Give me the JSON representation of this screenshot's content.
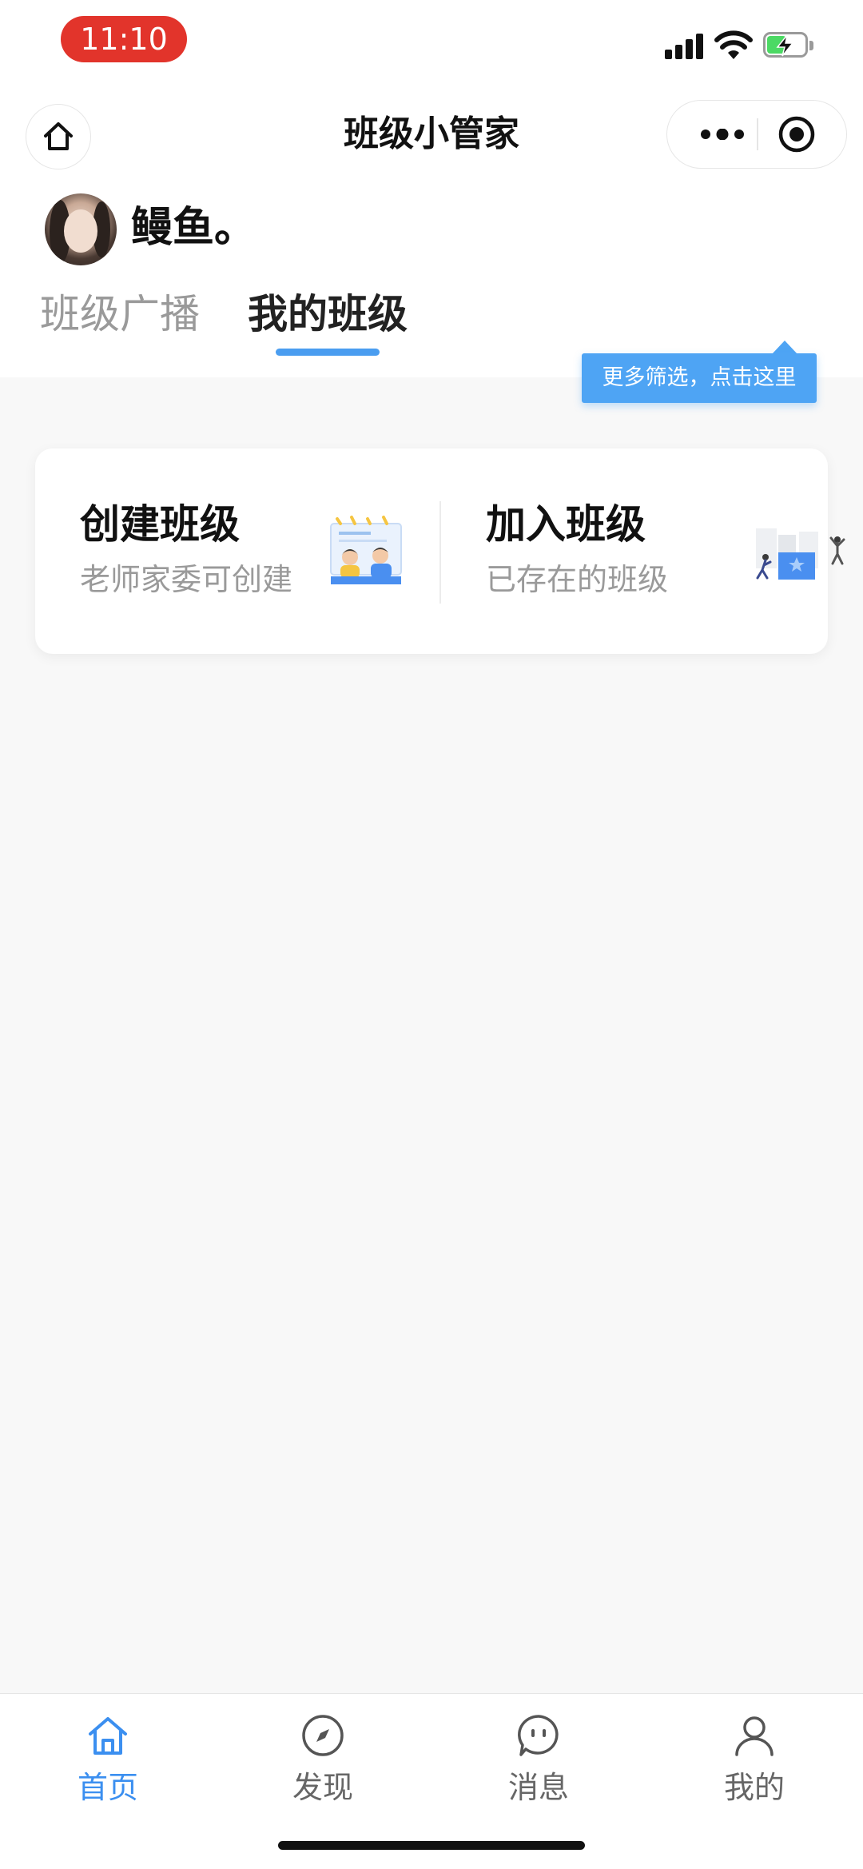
{
  "status_bar": {
    "time": "11:10"
  },
  "nav": {
    "title": "班级小管家"
  },
  "user": {
    "name": "鳗鱼。"
  },
  "tabs": [
    {
      "label": "班级广播",
      "active": false
    },
    {
      "label": "我的班级",
      "active": true
    }
  ],
  "tooltip": {
    "text": "更多筛选，点击这里"
  },
  "actions": {
    "create": {
      "title": "创建班级",
      "subtitle": "老师家委可创建"
    },
    "join": {
      "title": "加入班级",
      "subtitle": "已存在的班级"
    }
  },
  "tabbar": [
    {
      "label": "首页",
      "icon": "home-icon",
      "active": true
    },
    {
      "label": "发现",
      "icon": "compass-icon",
      "active": false
    },
    {
      "label": "消息",
      "icon": "chat-icon",
      "active": false
    },
    {
      "label": "我的",
      "icon": "person-icon",
      "active": false
    }
  ],
  "colors": {
    "accent": "#3b8ff0",
    "tooltip": "#4ea4f4",
    "time_pill": "#e2342b"
  }
}
